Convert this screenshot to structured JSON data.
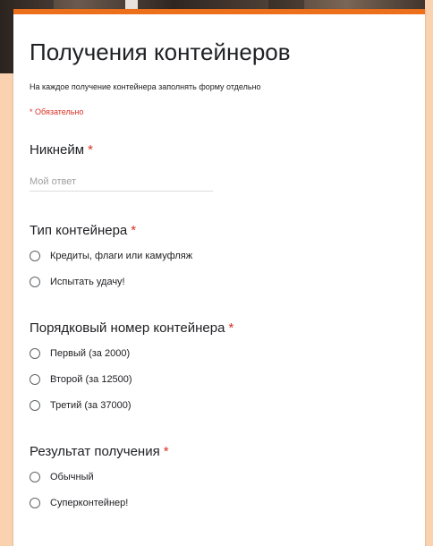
{
  "form": {
    "title": "Получения контейнеров",
    "description": "На каждое получение контейнера заполнять форму отдельно",
    "required_note": "* Обязательно"
  },
  "questions": {
    "nickname": {
      "label": "Никнейм",
      "required_mark": "*",
      "placeholder": "Мой ответ"
    },
    "container_type": {
      "label": "Тип контейнера",
      "required_mark": "*",
      "options": [
        "Кредиты, флаги или камуфляж",
        "Испытать удачу!"
      ]
    },
    "container_number": {
      "label": "Порядковый номер контейнера",
      "required_mark": "*",
      "options": [
        "Первый (за 2000)",
        "Второй (за 12500)",
        "Третий (за 37000)"
      ]
    },
    "result": {
      "label": "Результат получения",
      "required_mark": "*",
      "options": [
        "Обычный",
        "Суперконтейнер!"
      ]
    }
  },
  "colors": {
    "accent": "#ec6f1c",
    "required": "#d93025",
    "background": "#fbd2b0"
  }
}
